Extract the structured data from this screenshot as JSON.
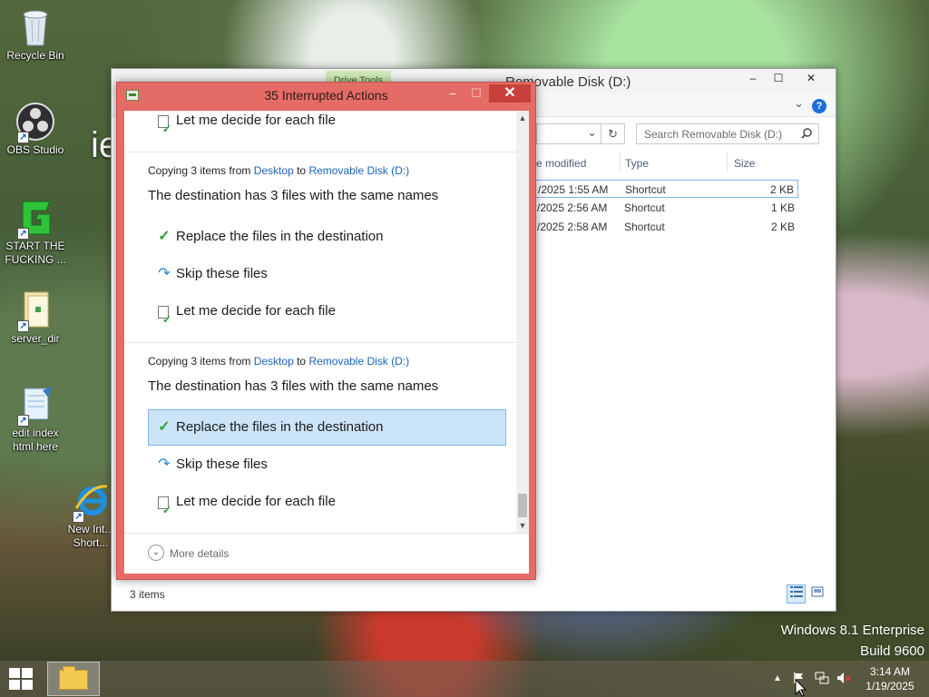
{
  "desktop": {
    "icons": [
      {
        "label": "Recycle Bin",
        "icon": "recycle-bin-icon"
      },
      {
        "label": "OBS Studio",
        "icon": "obs-studio-icon"
      },
      {
        "label": "START THE FUCKING ...",
        "icon": "green-g-app-icon"
      },
      {
        "label": "server_dir",
        "icon": "folder-icon"
      },
      {
        "label": "edit index html here",
        "icon": "notepad-icon"
      },
      {
        "label": "New Int... Short...",
        "icon": "internet-explorer-icon"
      }
    ],
    "side_text": "ie"
  },
  "explorer": {
    "title": "Removable Disk (D:)",
    "ribbon_tab": "Drive Tools",
    "search_placeholder": "Search Removable Disk (D:)",
    "columns": [
      "e modified",
      "Type",
      "Size"
    ],
    "rows": [
      {
        "modified": "/2025 1:55 AM",
        "type": "Shortcut",
        "size": "2 KB",
        "selected": true
      },
      {
        "modified": "/2025 2:56 AM",
        "type": "Shortcut",
        "size": "1 KB",
        "selected": false
      },
      {
        "modified": "/2025 2:58 AM",
        "type": "Shortcut",
        "size": "2 KB",
        "selected": false
      }
    ],
    "status": "3 items",
    "buttons": {
      "minimize": "–",
      "maximize": "☐",
      "close": "✕",
      "help": "?",
      "refresh": "↻",
      "dropdown": "⌄"
    }
  },
  "dialog": {
    "title": "35 Interrupted Actions",
    "buttons": {
      "minimize": "–",
      "maximize": "☐",
      "close": "✕"
    },
    "top_option": "Let me decide for each file",
    "groups": [
      {
        "copy_prefix": "Copying 3 items from ",
        "from": "Desktop",
        "to_word": " to ",
        "to": "Removable Disk (D:)",
        "heading": "The destination has 3 files with the same names",
        "options": [
          "Replace the files in the destination",
          "Skip these files",
          "Let me decide for each file"
        ]
      },
      {
        "copy_prefix": "Copying 3 items from ",
        "from": "Desktop",
        "to_word": " to ",
        "to": "Removable Disk (D:)",
        "heading": "The destination has 3 files with the same names",
        "options": [
          "Replace the files in the destination",
          "Skip these files",
          "Let me decide for each file"
        ]
      }
    ],
    "more_details": "More details",
    "highlight_color": "#cce4f7",
    "frame_color": "#e56b66"
  },
  "watermark": {
    "line1": "Windows 8.1 Enterprise",
    "line2": "Build 9600"
  },
  "taskbar": {
    "time": "3:14 AM",
    "date": "1/19/2025",
    "tray_icons": [
      "show-hidden-icons-icon",
      "action-center-flag-icon",
      "network-icon",
      "speaker-muted-icon"
    ]
  }
}
